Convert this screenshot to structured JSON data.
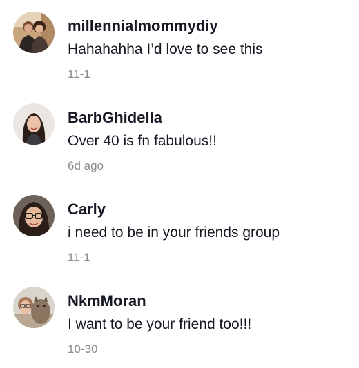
{
  "comments": [
    {
      "username": "millennialmommydiy",
      "text": "Hahahahha I’d love to see this",
      "time": "11-1",
      "avatar_icon": "avatar-couple-photo"
    },
    {
      "username": "BarbGhidella",
      "text": "Over 40 is fn fabulous!!",
      "time": "6d ago",
      "avatar_icon": "avatar-woman-photo"
    },
    {
      "username": "Carly",
      "text": "i need to be in your friends group",
      "time": "11-1",
      "avatar_icon": "avatar-woman-glasses-photo"
    },
    {
      "username": "NkmMoran",
      "text": "I want to be your friend too!!!",
      "time": "10-30",
      "avatar_icon": "avatar-woman-with-cat-photo"
    }
  ],
  "colors": {
    "username": "#161823",
    "text": "#161823",
    "timestamp": "#8a8b91",
    "background": "#ffffff"
  }
}
